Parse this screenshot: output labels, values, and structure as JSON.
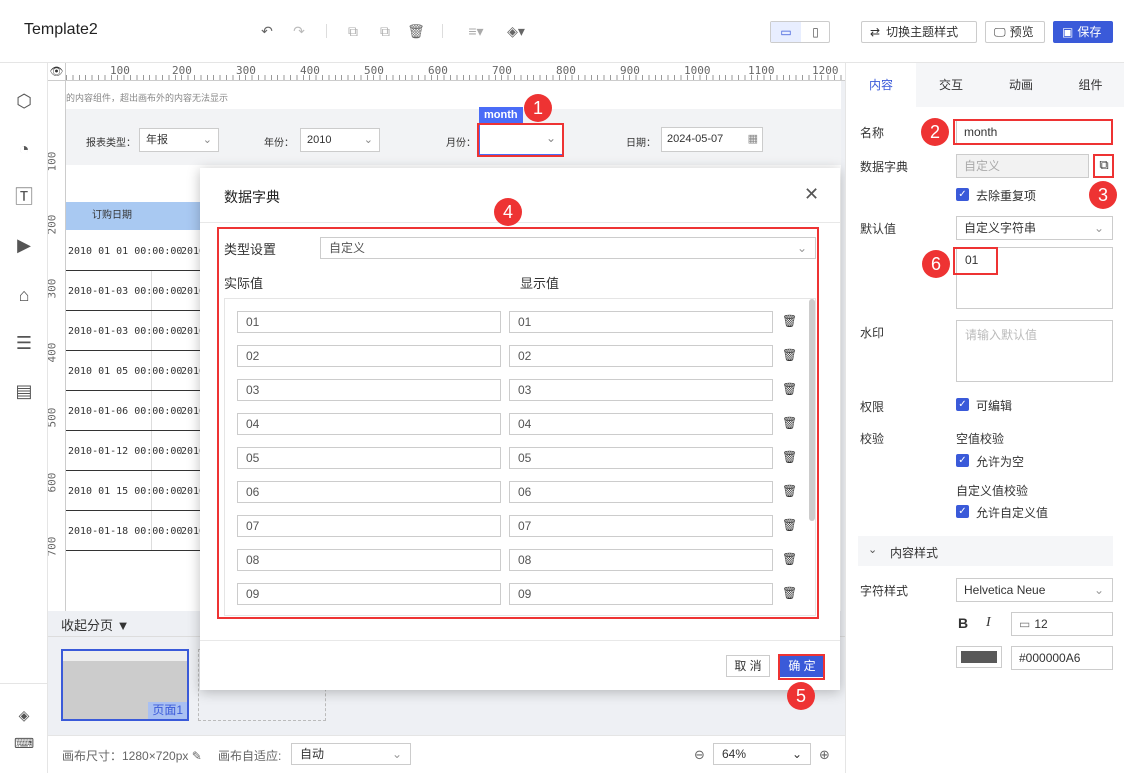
{
  "app": {
    "title": "Template2"
  },
  "topbar": {
    "theme_label": "切换主题样式",
    "preview_label": "预览",
    "save_label": "保存"
  },
  "ruler": {
    "h_ticks": [
      "100",
      "200",
      "300",
      "400",
      "500",
      "600",
      "700",
      "800",
      "900",
      "1000",
      "1100",
      "1200"
    ],
    "v_ticks": [
      "100",
      "200",
      "300",
      "400",
      "500",
      "600",
      "700"
    ]
  },
  "page": {
    "notice": "的内容组件，超出画布外的内容无法显示",
    "filters": {
      "report_type_label": "报表类型：",
      "report_type_value": "年报",
      "year_label": "年份：",
      "year_value": "2010",
      "month_label": "月份：",
      "month_tag": "month",
      "date_label": "日期：",
      "date_value": "2024-05-07"
    },
    "table_header": "订购日期",
    "table_rows": [
      {
        "date": "2010 01 01 00:00:00",
        "year": "2010"
      },
      {
        "date": "2010-01-03 00:00:00",
        "year": "2010"
      },
      {
        "date": "2010-01-03 00:00:00",
        "year": "2010"
      },
      {
        "date": "2010 01 05 00:00:00",
        "year": "2010"
      },
      {
        "date": "2010-01-06 00:00:00",
        "year": "2010"
      },
      {
        "date": "2010-01-12 00:00:00",
        "year": "2010"
      },
      {
        "date": "2010 01 15 00:00:00",
        "year": "2010"
      },
      {
        "date": "2010-01-18 00:00:00",
        "year": "2010"
      }
    ]
  },
  "pages": {
    "collapse_label": "收起分页",
    "page1_label": "页面1"
  },
  "dialog": {
    "title": "数据字典",
    "type_label": "类型设置",
    "type_value": "自定义",
    "actual_header": "实际值",
    "display_header": "显示值",
    "rows": [
      {
        "actual": "01",
        "display": "01"
      },
      {
        "actual": "02",
        "display": "02"
      },
      {
        "actual": "03",
        "display": "03"
      },
      {
        "actual": "04",
        "display": "04"
      },
      {
        "actual": "05",
        "display": "05"
      },
      {
        "actual": "06",
        "display": "06"
      },
      {
        "actual": "07",
        "display": "07"
      },
      {
        "actual": "08",
        "display": "08"
      },
      {
        "actual": "09",
        "display": "09"
      }
    ],
    "cancel_label": "取 消",
    "ok_label": "确 定"
  },
  "rightpanel": {
    "tabs": [
      "内容",
      "交互",
      "动画",
      "组件"
    ],
    "name_label": "名称",
    "name_value": "month",
    "dict_label": "数据字典",
    "dict_value": "自定义",
    "dedupe_label": "去除重复项",
    "default_label": "默认值",
    "default_type": "自定义字符串",
    "default_value": "01",
    "watermark_label": "水印",
    "watermark_placeholder": "请输入默认值",
    "perm_label": "权限",
    "editable_label": "可编辑",
    "validate_label": "校验",
    "null_check_label": "空值校验",
    "allow_null_label": "允许为空",
    "custom_check_label": "自定义值校验",
    "allow_custom_label": "允许自定义值",
    "content_style_label": "内容样式",
    "font_style_label": "字符样式",
    "font_value": "Helvetica Neue",
    "font_size": "12",
    "color_value": "#000000A6"
  },
  "bottombar": {
    "canvas_size_label": "画布尺寸：1280×720px",
    "adapt_label": "画布自适应:",
    "adapt_value": "自动",
    "zoom_value": "64%"
  },
  "badges": [
    "1",
    "2",
    "3",
    "4",
    "5",
    "6"
  ],
  "colors": {
    "accent": "#3a5ad9",
    "highlight": "#e33333",
    "tag_bg": "#4a6cf7"
  }
}
